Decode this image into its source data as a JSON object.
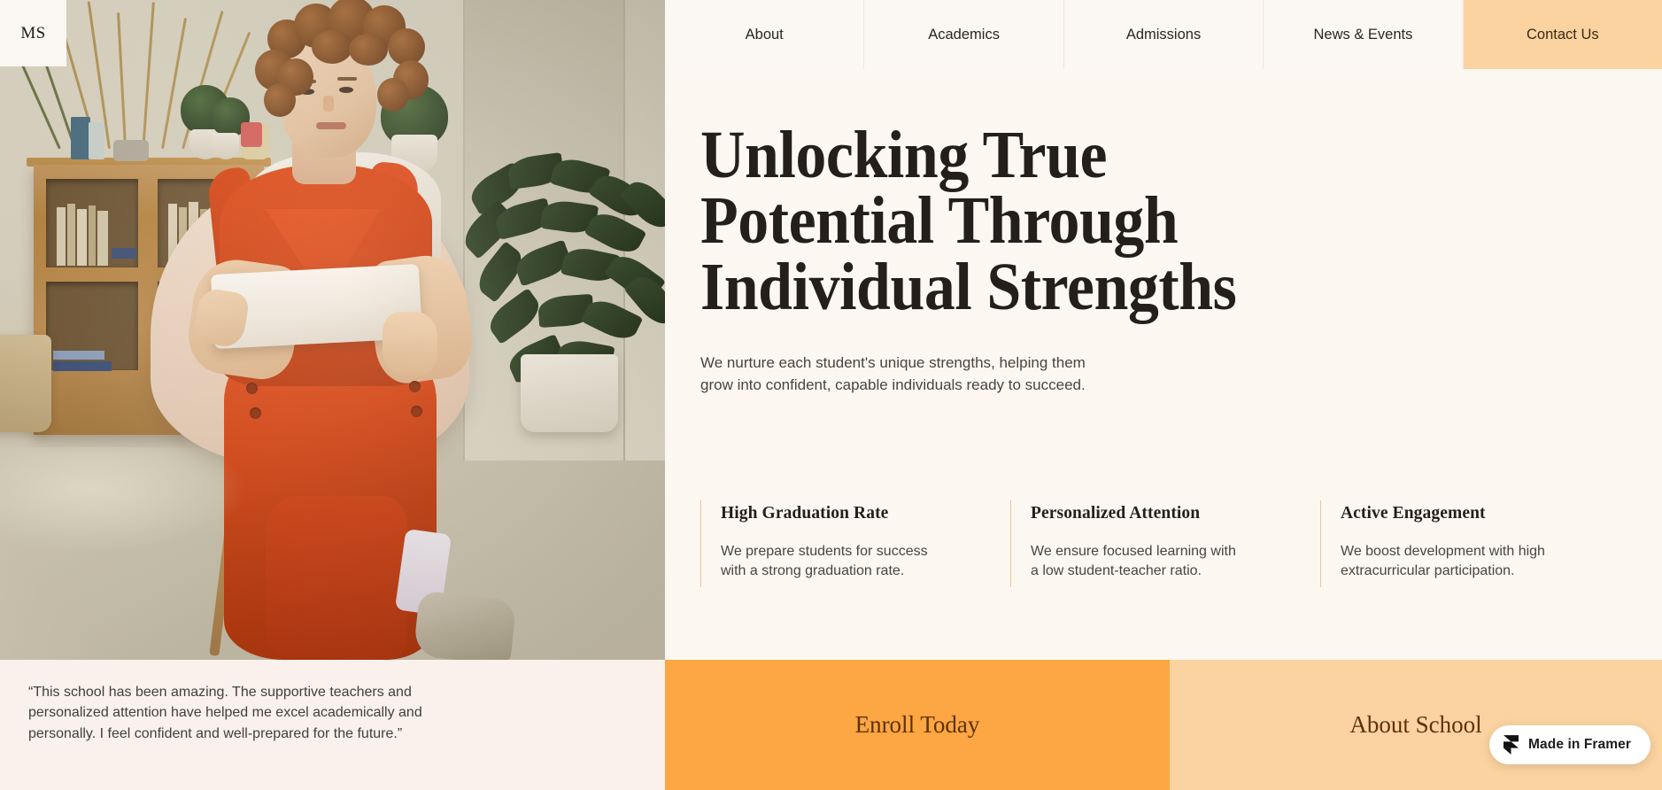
{
  "logo": {
    "text": "MS",
    "name": "ms-logo"
  },
  "nav": {
    "items": [
      {
        "label": "About",
        "name": "nav-about"
      },
      {
        "label": "Academics",
        "name": "nav-academics"
      },
      {
        "label": "Admissions",
        "name": "nav-admissions"
      },
      {
        "label": "News & Events",
        "name": "nav-news-events"
      },
      {
        "label": "Contact Us",
        "name": "nav-contact-us"
      }
    ]
  },
  "hero": {
    "title_line1": "Unlocking True",
    "title_line2": "Potential Through",
    "title_line3": "Individual Strengths",
    "subtitle_line1": "We nurture each student's unique strengths, helping them",
    "subtitle_line2": "grow into confident, capable individuals ready to succeed.",
    "image_alt": "Student with curly hair sitting on a chair holding a tablet in a bright room"
  },
  "features": [
    {
      "title": "High Graduation Rate",
      "desc_line1": "We prepare students for success",
      "desc_line2": "with a strong graduation rate."
    },
    {
      "title": "Personalized Attention",
      "desc_line1": "We ensure focused learning with",
      "desc_line2": "a low student-teacher ratio."
    },
    {
      "title": "Active Engagement",
      "desc_line1": "We boost development with high",
      "desc_line2": "extracurricular participation."
    }
  ],
  "testimonial": {
    "line1": "“This school has been amazing. The supportive teachers and",
    "line2": "personalized attention have helped me excel academically and",
    "line3": "personally. I feel confident and well-prepared for the future.”"
  },
  "cta": {
    "enroll_label": "Enroll Today",
    "about_label": "About School"
  },
  "badge": {
    "label": "Made in Framer",
    "icon": "framer-icon"
  },
  "colors": {
    "page_bg": "#FBF6F0",
    "panel_bg": "#FCF7F1",
    "nav_bg": "#FBF7F2",
    "accent_orange": "#FCA644",
    "accent_peach": "#FBD3A0",
    "testimonial_bg": "#FAF0EC",
    "feature_rule": "#E2C896",
    "text_dark": "#231F1A",
    "text_body": "#4B443D",
    "cta_text": "#5D3205"
  }
}
